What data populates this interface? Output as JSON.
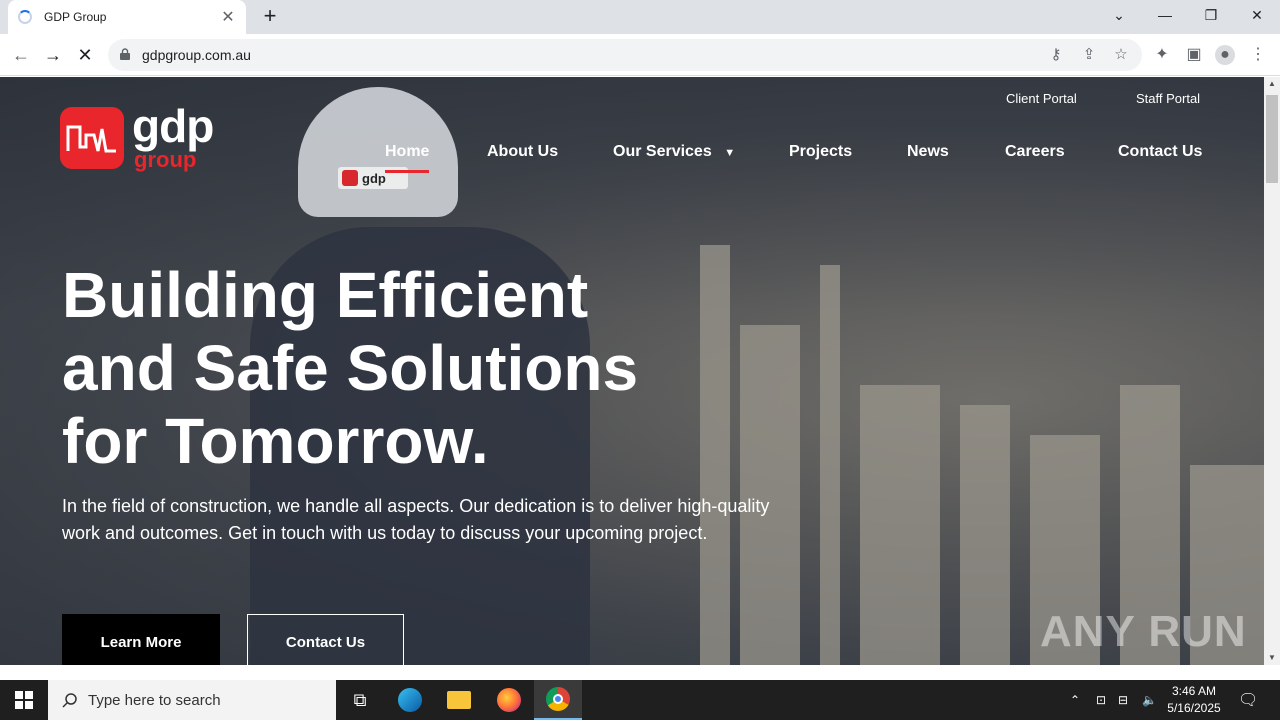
{
  "browser": {
    "tab_title": "GDP Group",
    "url": "gdpgroup.com.au"
  },
  "site": {
    "logo_main": "gdp",
    "logo_sub": "group",
    "helmet_logo": "gdp",
    "top_links": [
      "Client Portal",
      "Staff Portal"
    ],
    "nav": [
      "Home",
      "About Us",
      "Our Services",
      "Projects",
      "News",
      "Careers",
      "Contact Us"
    ],
    "active_nav": "Home",
    "hero_title": [
      "Building Efficient",
      "and Safe Solutions",
      "for Tomorrow."
    ],
    "hero_text": "In the field of construction, we handle all aspects. Our dedication is to deliver high-quality work and outcomes. Get in touch with us today to discuss your upcoming project.",
    "btn_learn": "Learn More",
    "btn_contact": "Contact Us",
    "watermark": "ANY RUN"
  },
  "taskbar": {
    "search_placeholder": "Type here to search",
    "time": "3:46 AM",
    "date": "5/16/2025"
  },
  "colors": {
    "brand_red": "#e8262b",
    "taskbar": "#1f1f1f"
  }
}
